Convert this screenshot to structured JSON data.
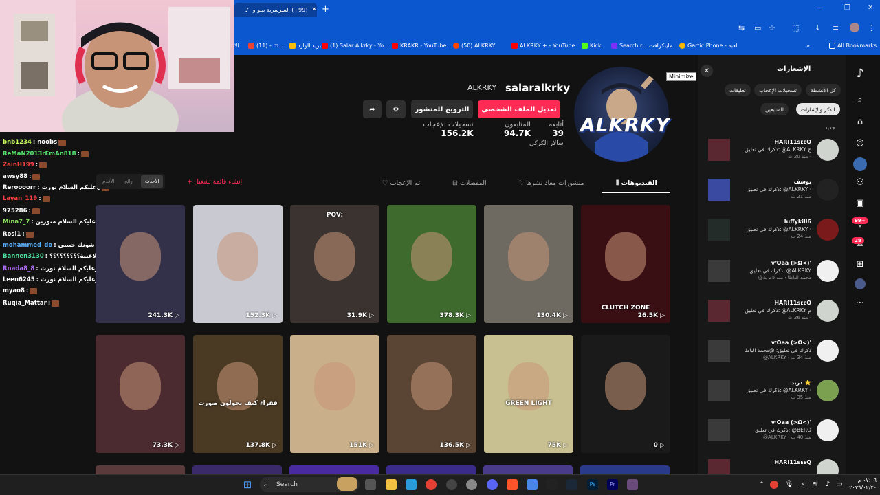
{
  "browser": {
    "active_tab_title": "(99+) السرسرية بيبو و",
    "bookmarks": [
      "(11) - m...",
      "البريد الوارد",
      "(1) Salar Alkrky - Yo...",
      "KRAKR - YouTube",
      "(50) ALKRKY",
      "ALKRKY + - YouTube",
      "Kick",
      "Search r...",
      "ماينكرافت",
      "Gartic Phone - لعبة",
      "All Bookmarks"
    ]
  },
  "chat": [
    {
      "user": "bnb1234",
      "msg": ": noobs",
      "color": "#c8ff5a"
    },
    {
      "user": "ReMaN2013rEmAn818",
      "msg": ":",
      "color": "#56e06a"
    },
    {
      "user": "ZainH199",
      "msg": ":",
      "color": "#ff4040"
    },
    {
      "user": "awsy88",
      "msg": ":",
      "color": "#ffffff"
    },
    {
      "user": "Reroooorr",
      "msg": ": وعليكم السلام نورت",
      "color": "#ffffff"
    },
    {
      "user": "Layan_119",
      "msg": ":",
      "color": "#ff4040"
    },
    {
      "user": "975286",
      "msg": ":",
      "color": "#ffffff"
    },
    {
      "user": "Mina7_7",
      "msg": ": و عليكم السلام متورين",
      "color": "#8ae060"
    },
    {
      "user": "Rosl1",
      "msg": ":",
      "color": "#ffffff"
    },
    {
      "user": "mohammed_do",
      "msg": ": شروني شونك حبيبي",
      "color": "#5ab0ff"
    },
    {
      "user": "Bannen3130",
      "msg": ": شوف الاغنية؟؟؟؟؟؟؟؟؟",
      "color": "#4fe0a0"
    },
    {
      "user": "Rnada8_8",
      "msg": ": وعليكم السلام نورت",
      "color": "#b070ff"
    },
    {
      "user": "Leen6245",
      "msg": ": وعليكم السلام نورت",
      "color": "#ffffff"
    },
    {
      "user": "myao8",
      "msg": ":",
      "color": "#ffffff"
    },
    {
      "user": "Ruqia_Mattar",
      "msg": ":",
      "color": "#ffffff"
    }
  ],
  "profile": {
    "username": "salaralkrky",
    "nickname": "ALKRKY",
    "edit_label": "تعديل الملف الشخصي",
    "promote_label": "الترويج للمنشور",
    "following_n": "39",
    "following_l": "أتابعه",
    "followers_n": "94.7K",
    "followers_l": "المتابعون",
    "likes_n": "156.2K",
    "likes_l": "تسجيلات الإعجاب",
    "bio": "سالار الكركي",
    "avatar_text": "ALKRKY",
    "minimize_tip": "Minimize"
  },
  "tabs": {
    "videos": "الفيديوهات",
    "reposts": "منشورات معاد نشرها",
    "favorites": "المفضلات",
    "liked": "تم الإعجاب",
    "playlist": "+ إنشاء قائمة تشغيل",
    "sort": [
      "الأحدث",
      "رائج",
      "الأقدم"
    ]
  },
  "videos": [
    {
      "views": "26.5K",
      "bg": "#3a0f14",
      "cap": "CLUTCH ZONE"
    },
    {
      "views": "130.4K",
      "bg": "#6e6a62",
      "cap": ""
    },
    {
      "views": "378.3K",
      "bg": "#3e6a2e",
      "cap": ""
    },
    {
      "views": "31.9K",
      "bg": "#3a3330",
      "cap": "POV:"
    },
    {
      "views": "152.3K",
      "bg": "#c9c9d2",
      "cap": ""
    },
    {
      "views": "241.3K",
      "bg": "#33304a",
      "cap": ""
    },
    {
      "views": "0",
      "bg": "#1a1a1a",
      "cap": ""
    },
    {
      "views": "75K",
      "bg": "#c8c090",
      "cap": "GREEN LIGHT"
    },
    {
      "views": "136.5K",
      "bg": "#5a4534",
      "cap": ""
    },
    {
      "views": "151K",
      "bg": "#c9b08a",
      "cap": ""
    },
    {
      "views": "137.8K",
      "bg": "#4a3a24",
      "cap": "فقراء كيف يحولون صورت"
    },
    {
      "views": "73.3K",
      "bg": "#4b2a30",
      "cap": ""
    }
  ],
  "notifications": {
    "title": "الإشعارات",
    "chips": [
      "كل الأنشطة",
      "تسجيلات الإعجاب",
      "تعليقات",
      "الذكر والإشارات",
      "المتابعين"
    ],
    "new_label": "جديد",
    "items": [
      {
        "name": "HARI11sᴇᴇQ",
        "text": "ذكرك في تعليق: @ALKRKY ح",
        "time": "منذ 20 ث ·",
        "av": "#cfd4cf",
        "th": "#5a2830"
      },
      {
        "name": "يوسف",
        "text": "ذكرك في تعليق: @ALKRKY ·",
        "time": "منذ 21 ث",
        "av": "#222",
        "th": "#3a4aa0"
      },
      {
        "name": "luffykill6",
        "text": "ذكرك في تعليق: @ALKRKY ·",
        "time": "منذ 24 ث",
        "av": "#7a1a1a",
        "th": "#242c2a"
      },
      {
        "name": "ᴠʳOaa (>Ω<)'",
        "text": "ذكرك في تعليق: @ALKRKY",
        "time": "@محمد الباطا · منذ 25 ث",
        "av": "#f0f0f0",
        "th": "#3a3a3a"
      },
      {
        "name": "HARI11sᴇᴇQ",
        "text": "ذكرك في تعليق: @ALKRKY م",
        "time": "منذ 26 ث ·",
        "av": "#cfd4cf",
        "th": "#5a2830"
      },
      {
        "name": "ᴠʳOaa (>Ω<)'",
        "text": "ذكرك في تعليق: @محمد الباطا",
        "time": "@ALKRKY · منذ 34 ث",
        "av": "#f0f0f0",
        "th": "#3a3a3a"
      },
      {
        "name": "دريد ⭐",
        "text": "ذكرك في تعليق: @ALKRKY ·",
        "time": "منذ 35 ث",
        "av": "#7aa050",
        "th": "#3a3a3a"
      },
      {
        "name": "ᴠʳOaa (>Ω<)'",
        "text": "ذكرك في تعليق: @BERO",
        "time": "@ALKRKY · منذ 40 ث",
        "av": "#f0f0f0",
        "th": "#3a3a3a"
      },
      {
        "name": "HARI11sᴇᴇQ",
        "text": "",
        "time": "",
        "av": "#cfd4cf",
        "th": "#5a2830"
      }
    ]
  },
  "sidebar_badges": {
    "inbox": "99+",
    "activity": "28"
  },
  "taskbar": {
    "search": "Search",
    "time": "٠٧:٠٦ م",
    "date": "٢٠٢٦/٠٢/٢٠"
  }
}
